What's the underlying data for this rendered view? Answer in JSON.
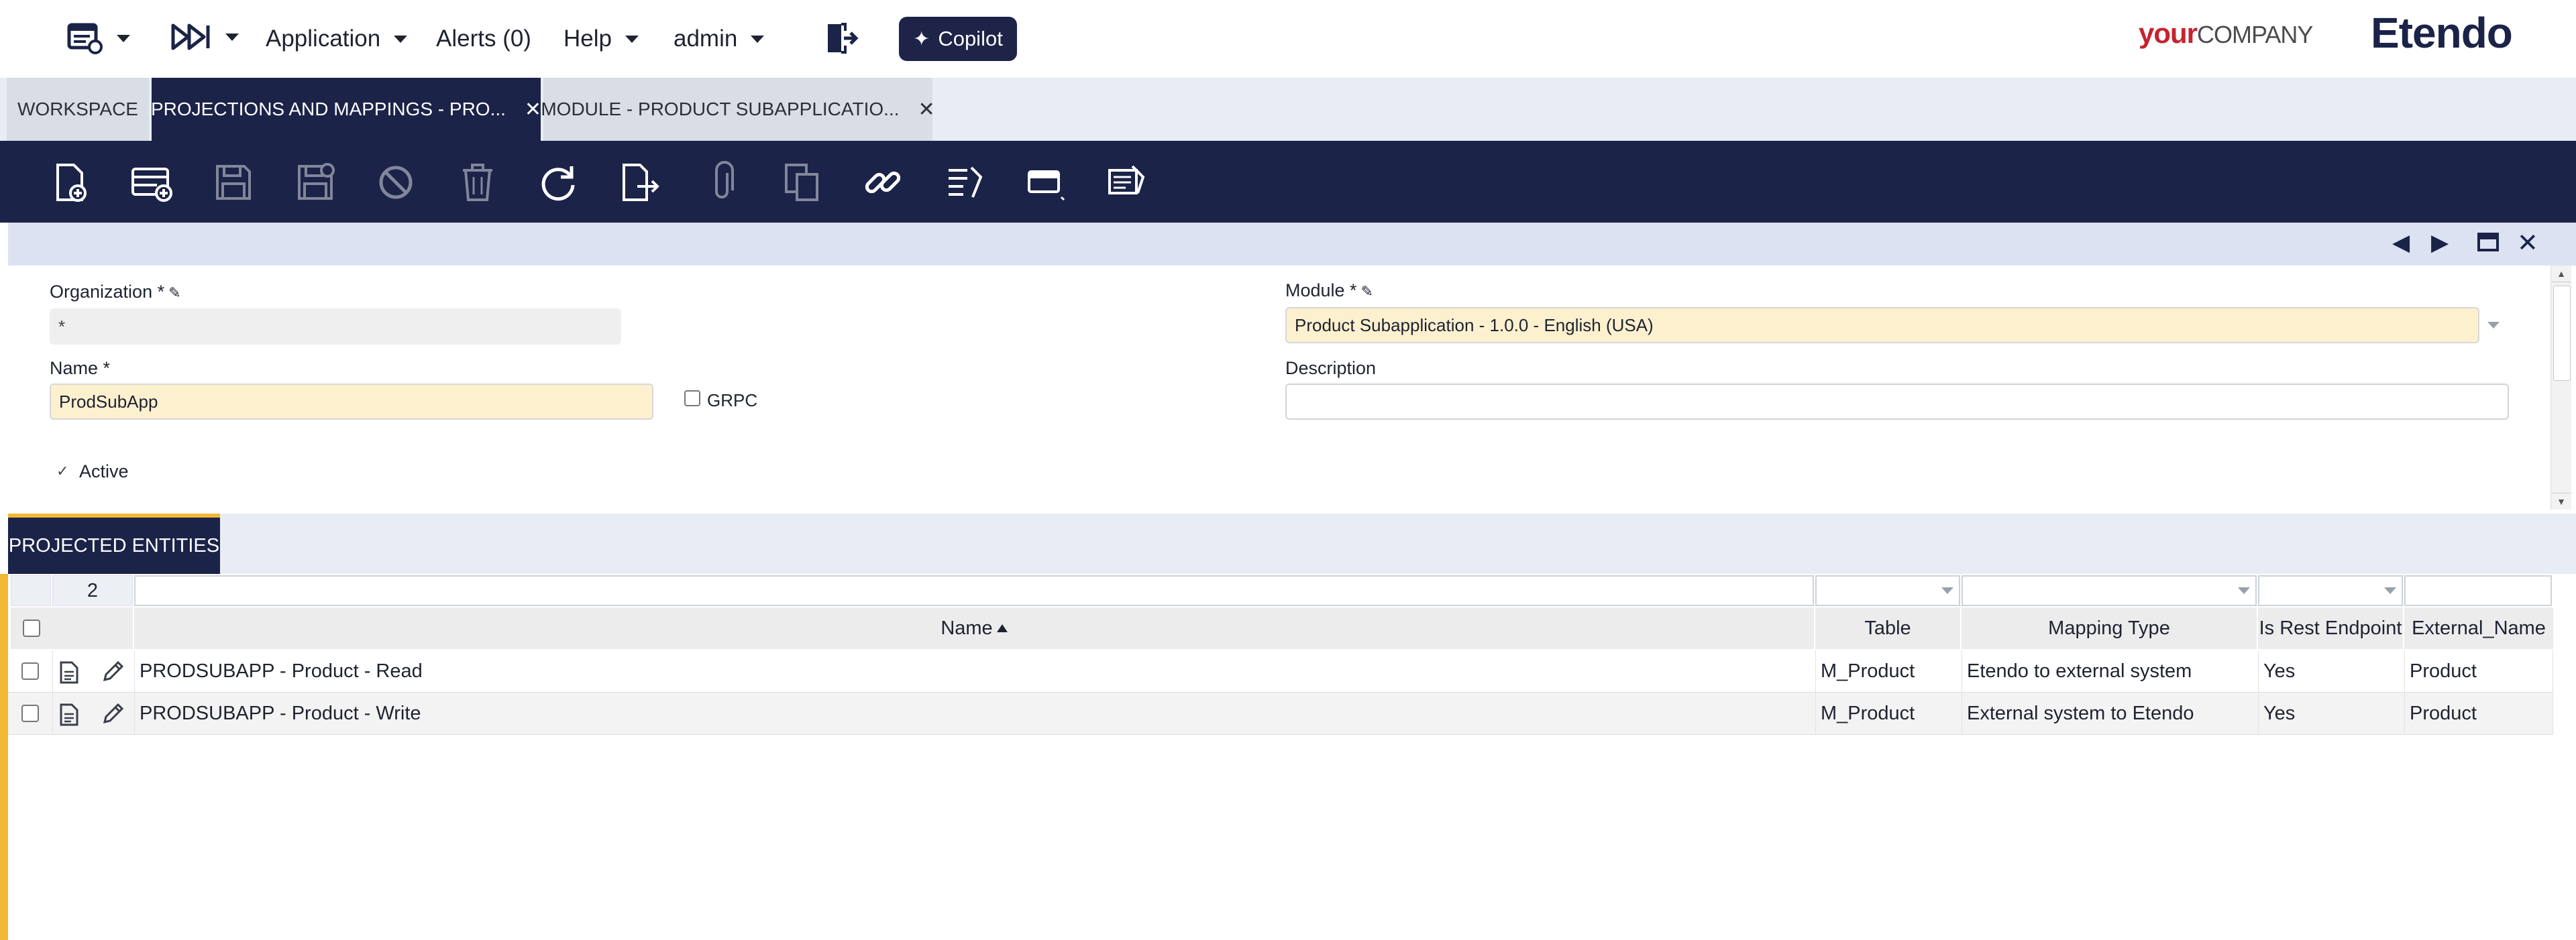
{
  "topnav": {
    "application": "Application",
    "alerts": "Alerts (0)",
    "help": "Help",
    "user": "admin",
    "copilot": "Copilot",
    "logo_your": "your",
    "logo_company": "COMPANY",
    "brand": "Etendo"
  },
  "tabs": [
    {
      "label": "WORKSPACE"
    },
    {
      "label": "PROJECTIONS AND MAPPINGS - PRO..."
    },
    {
      "label": "MODULE - PRODUCT SUBAPPLICATIO..."
    }
  ],
  "toolbar": {
    "icons": [
      "new-document-icon",
      "new-row-icon",
      "save-icon",
      "save-close-icon",
      "undo-icon",
      "delete-icon",
      "refresh-icon",
      "export-icon",
      "attachment-icon",
      "copy-record-icon",
      "link-icon",
      "audit-icon",
      "grid-view-icon",
      "report-icon"
    ]
  },
  "form": {
    "organization_label": "Organization *",
    "organization_value": "*",
    "module_label": "Module *",
    "module_value": "Product Subapplication - 1.0.0 - English (USA)",
    "name_label": "Name *",
    "name_value": "ProdSubApp",
    "grpc_label": "GRPC",
    "grpc_checked": false,
    "description_label": "Description",
    "description_value": "",
    "active_label": "Active",
    "active_checked": true
  },
  "subtab": {
    "label": "PROJECTED ENTITIES"
  },
  "grid": {
    "row_count": "2",
    "columns": [
      "Name",
      "Table",
      "Mapping Type",
      "Is Rest Endpoint",
      "External_Name"
    ],
    "rows": [
      {
        "name": "PRODSUBAPP - Product - Read",
        "table": "M_Product",
        "mapping_type": "Etendo to external system",
        "is_rest_endpoint": "Yes",
        "external_name": "Product"
      },
      {
        "name": "PRODSUBAPP - Product - Write",
        "table": "M_Product",
        "mapping_type": "External system to Etendo",
        "is_rest_endpoint": "Yes",
        "external_name": "Product"
      }
    ]
  },
  "colors": {
    "navy": "#1b2348",
    "accent_yellow": "#f2b733",
    "required_field": "#fcf0cf",
    "brand_red": "#c5232f"
  }
}
